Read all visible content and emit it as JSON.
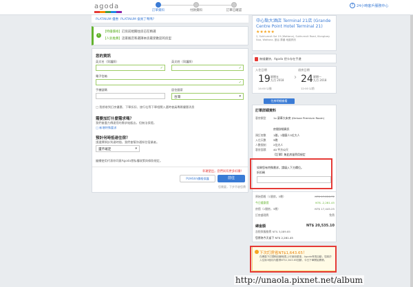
{
  "header": {
    "logo": "agoda",
    "steps": [
      "訂單資料",
      "付款資料",
      "訂單已確認"
    ],
    "help": "24小時客戶服務中心"
  },
  "info_bar": [
    "PLATINUM 優惠",
    "PLATINUM 會員了嗎嗎?"
  ],
  "green_box": {
    "line1_tag": "【特優價格】",
    "line1_text": "訂房前相關住房已在精選",
    "line2_tag": "【人氣推薦】",
    "line2_text": "這家飯店和選擇本房最受歡迎的房型"
  },
  "form": {
    "title": "您的資訊",
    "first_name_label": "英文名（同護照）",
    "last_name_label": "英文姓（同護照）",
    "email_label": "電子信箱",
    "phone_label": "手機號碼",
    "country_label": "居住國家",
    "country_value": "台灣",
    "newsletter_note": "□ 我想收到訂房優惠、下單折扣、旅行社等下單相關入選時會員專屬優惠消息",
    "special_title": "需要加訂什麼需求嗎？",
    "special_note": "我們會盡力傳達您的需求給飯店，但無法保證。",
    "special_link": "□ 新增特殊要求",
    "arrival_title": "預計何時抵達住宿？",
    "arrival_note": "請選擇預計到達時間，我們會幫你通知住宿業者。",
    "arrival_select": "還不確定",
    "terms_note": "繼續使用代表你同意Agoda隱私權政策與條款規定。",
    "warn": "幸運使出，您們尚有更多好康！",
    "save_button": "PUHShh價格保護",
    "next_button": "前往",
    "below_note": "您需要，下步不收您費"
  },
  "sidebar": {
    "hotel_name": "中心點大酒店 Terminal 21店 (Grande Centre Point Hotel Terminal 21)",
    "stars": "★★★★★",
    "address": "2, Sukhumvit Soi 19 (Wattana), Sukhumvit Road, Klongtoey Nua, Wattana, 曼谷 泰國 地圖資訊",
    "safe_text": "無縫優快，Agoda 把卡存在手邊",
    "checkin_label": "入住日期",
    "checkin_day": "19",
    "checkin_dw": "星期五\n九月 2018",
    "checkin_time": "14:00 以後",
    "checkout_label": "退房日期",
    "checkout_day": "24",
    "checkout_dw": "星期一\n九月 2018",
    "checkout_time": "12:00 以前",
    "chip": "住房明細查看",
    "details_title": "訂單詳細資料",
    "details": [
      {
        "k": "客房類型",
        "v": "1x 豪華大床房 (Deluxe Premium Room)"
      },
      {
        "k": "",
        "v": "房間詳細資訊"
      },
      {
        "k": "預訂房數",
        "v": "1間，1間客人5位大人"
      },
      {
        "k": "入住天數",
        "v": "5晚"
      },
      {
        "k": "人數限制",
        "v": "2位大人"
      },
      {
        "k": "客房面積",
        "v": "40 平方公尺"
      },
      {
        "k": "",
        "v": "【訂單】無此房量費用規定"
      }
    ],
    "special_req_text": "如果您有特殊需求，請填入下方欄位。",
    "special_req_label": "折扣碼",
    "price_rows": [
      {
        "k": "原始價格（1間房，5晚）",
        "v": "NT$ 17,226.72",
        "strike": true
      },
      {
        "k": "今日優惠價",
        "v": "NT$ -2,281.45",
        "green": true
      },
      {
        "k": "房價（1間房，5晚）",
        "v": "NT$ 17,445.25"
      },
      {
        "k": "訂房處理費",
        "v": "免費"
      }
    ],
    "total_label": "總金額",
    "total_value": "NT$ 20,535.10",
    "tax_note": "含稅與服務費 NT$ 3,089.85",
    "save_note": "您將為今天省下 NT$ 2,281.45",
    "promo_title": "下次訂房省NT$1,643.65！",
    "promo_desc": "在網頁下訂閱時回饋就馬上可使用優惠，Agoda會員自動，您將於入住後3個月內獲得NT$1,643.65回饋，今日下單開始累積。"
  },
  "watermark": "http://unaola.pixnet.net/album"
}
